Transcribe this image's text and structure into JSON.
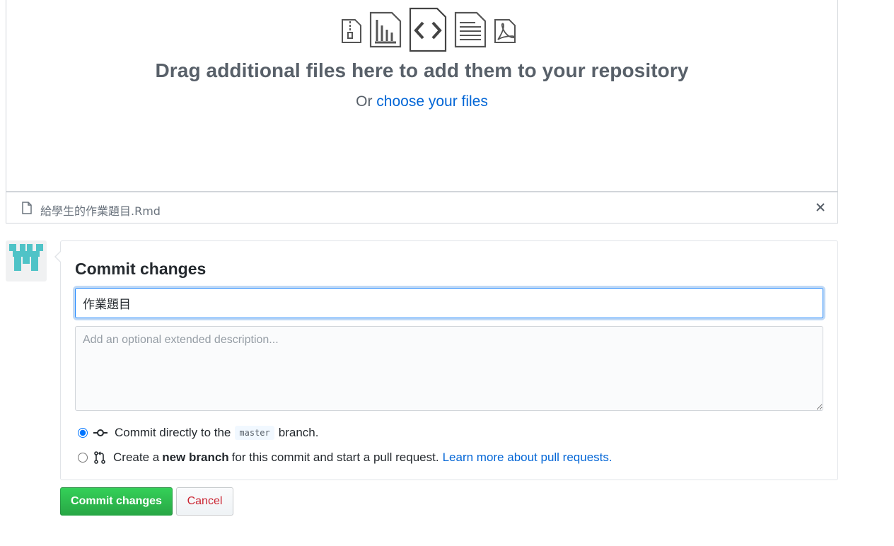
{
  "dropzone": {
    "title": "Drag additional files here to add them to your repository",
    "sub_prefix": "Or",
    "choose_link": "choose your files",
    "icons": [
      "file-zip-icon",
      "file-chart-icon",
      "file-code-icon",
      "file-text-icon",
      "file-pdf-icon"
    ]
  },
  "file": {
    "name": "給學生的作業題目.Rmd"
  },
  "commit": {
    "title": "Commit changes",
    "summary_value": "作業題目",
    "description_placeholder": "Add an optional extended description...",
    "option_direct": {
      "prefix": "Commit directly to the",
      "branch": "master",
      "suffix": "branch."
    },
    "option_new_branch": {
      "prefix": "Create a",
      "bold": "new branch",
      "suffix": "for this commit and start a pull request.",
      "link": "Learn more about pull requests."
    }
  },
  "buttons": {
    "commit": "Commit changes",
    "cancel": "Cancel"
  },
  "colors": {
    "link": "#0366d6",
    "commit_button": "#28a745",
    "cancel_text": "#cb2431",
    "avatar": "#4fc3c7"
  }
}
